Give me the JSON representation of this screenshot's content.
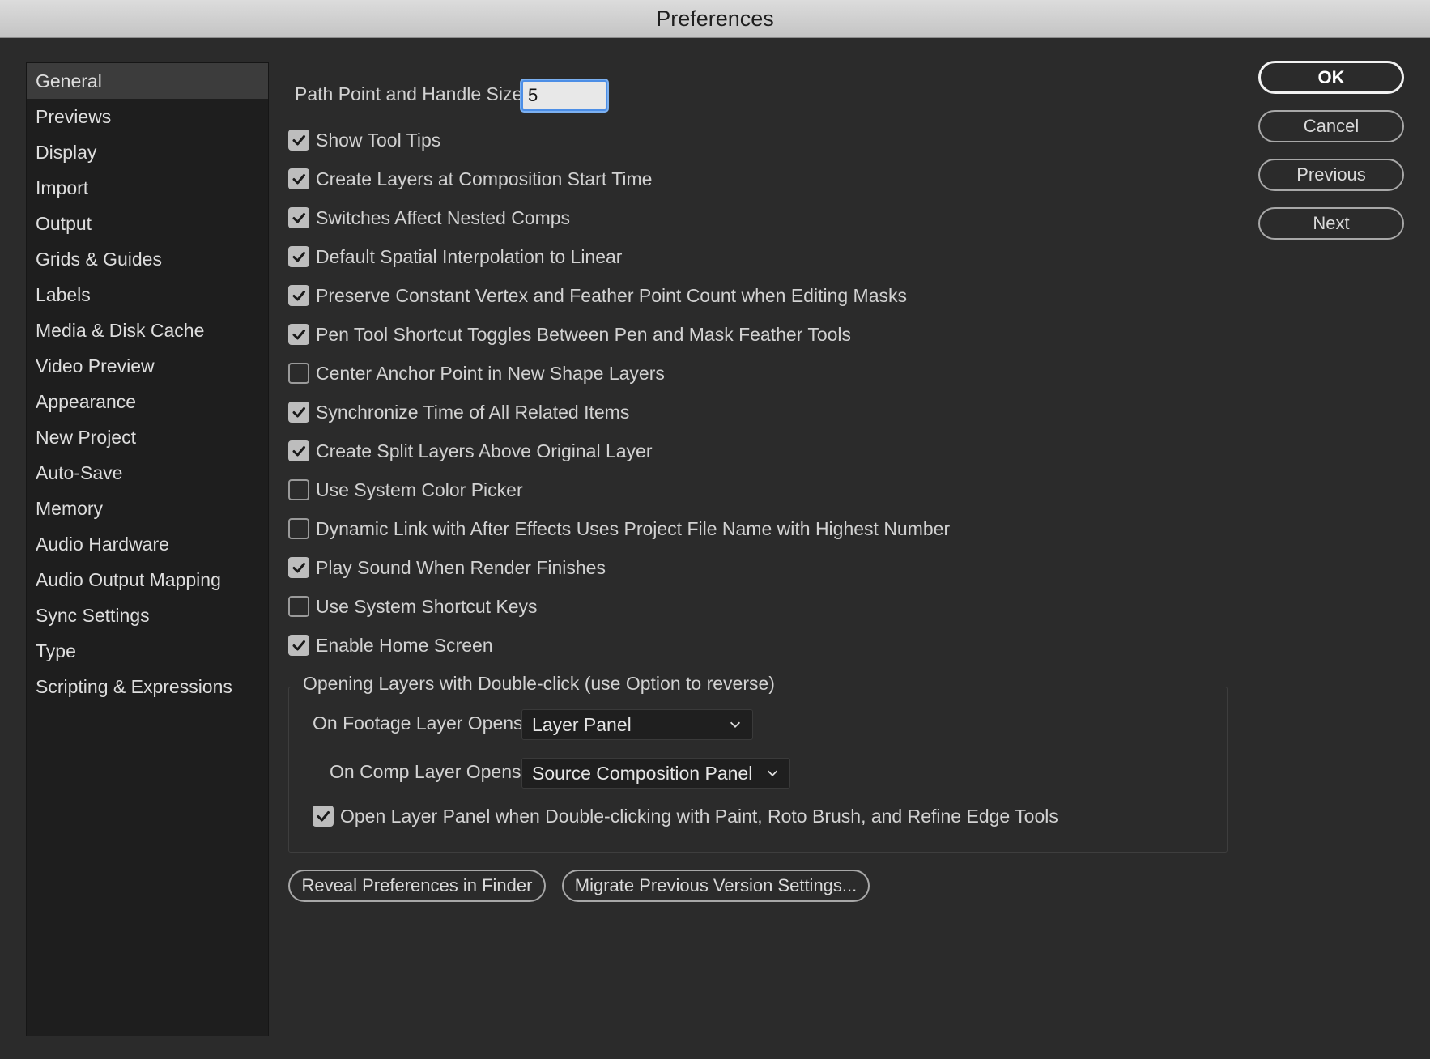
{
  "window": {
    "title": "Preferences"
  },
  "sidebar": {
    "items": [
      {
        "label": "General",
        "selected": true
      },
      {
        "label": "Previews"
      },
      {
        "label": "Display"
      },
      {
        "label": "Import"
      },
      {
        "label": "Output"
      },
      {
        "label": "Grids & Guides"
      },
      {
        "label": "Labels"
      },
      {
        "label": "Media & Disk Cache"
      },
      {
        "label": "Video Preview"
      },
      {
        "label": "Appearance"
      },
      {
        "label": "New Project"
      },
      {
        "label": "Auto-Save"
      },
      {
        "label": "Memory"
      },
      {
        "label": "Audio Hardware"
      },
      {
        "label": "Audio Output Mapping"
      },
      {
        "label": "Sync Settings"
      },
      {
        "label": "Type"
      },
      {
        "label": "Scripting & Expressions"
      }
    ]
  },
  "general": {
    "path_point_label": "Path Point and Handle Size:",
    "path_point_value": "5",
    "options": [
      {
        "label": "Show Tool Tips",
        "checked": true
      },
      {
        "label": "Create Layers at Composition Start Time",
        "checked": true
      },
      {
        "label": "Switches Affect Nested Comps",
        "checked": true
      },
      {
        "label": "Default Spatial Interpolation to Linear",
        "checked": true
      },
      {
        "label": "Preserve Constant Vertex and Feather Point Count when Editing Masks",
        "checked": true
      },
      {
        "label": "Pen Tool Shortcut Toggles Between Pen and Mask Feather Tools",
        "checked": true
      },
      {
        "label": "Center Anchor Point in New Shape Layers",
        "checked": false
      },
      {
        "label": "Synchronize Time of All Related Items",
        "checked": true
      },
      {
        "label": "Create Split Layers Above Original Layer",
        "checked": true
      },
      {
        "label": "Use System Color Picker",
        "checked": false
      },
      {
        "label": "Dynamic Link with After Effects Uses Project File Name with Highest Number",
        "checked": false
      },
      {
        "label": "Play Sound When Render Finishes",
        "checked": true
      },
      {
        "label": "Use System Shortcut Keys",
        "checked": false
      },
      {
        "label": "Enable Home Screen",
        "checked": true
      }
    ],
    "double_click_group": {
      "legend": "Opening Layers with Double-click (use Option to reverse)",
      "footage_label": "On Footage Layer Opens:",
      "footage_value": "Layer Panel",
      "comp_label": "On Comp Layer Opens:",
      "comp_value": "Source Composition Panel",
      "open_layer_label": "Open Layer Panel when Double-clicking with Paint, Roto Brush, and Refine Edge Tools",
      "open_layer_checked": true
    },
    "reveal_button": "Reveal Preferences in Finder",
    "migrate_button": "Migrate Previous Version Settings..."
  },
  "actions": {
    "ok": "OK",
    "cancel": "Cancel",
    "previous": "Previous",
    "next": "Next"
  },
  "colors": {
    "background": "#2b2b2b",
    "sidebar_bg": "#1e1e1e",
    "sidebar_selected": "#3c3c3c",
    "focus_ring": "#4c8ee6"
  }
}
